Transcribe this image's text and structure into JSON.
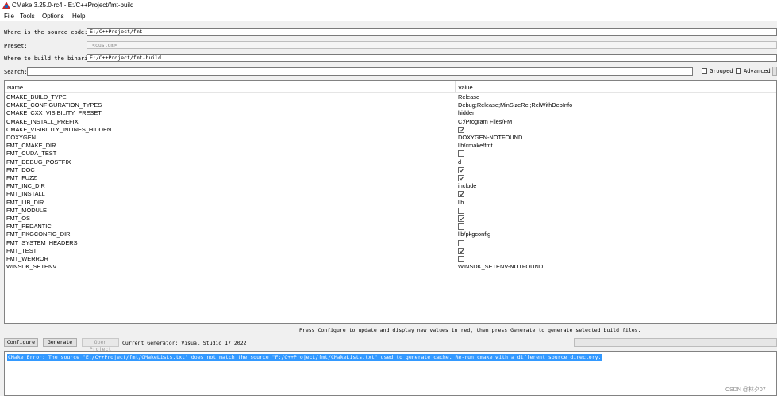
{
  "window": {
    "title": "CMake 3.25.0-rc4 - E:/C++Project/fmt-build"
  },
  "menu": [
    "File",
    "Tools",
    "Options",
    "Help"
  ],
  "paths": {
    "source_label": "Where is the source code:",
    "source_value": "E:/C++Project/fmt",
    "preset_label": "Preset:",
    "preset_value": "<custom>",
    "binaries_label": "Where to build the binaries:",
    "binaries_value": "E:/C++Project/fmt-build"
  },
  "search": {
    "label": "Search:",
    "value": ""
  },
  "options": {
    "grouped_label": "Grouped",
    "advanced_label": "Advanced"
  },
  "table": {
    "headers": {
      "name": "Name",
      "value": "Value"
    },
    "rows": [
      {
        "name": "CMAKE_BUILD_TYPE",
        "type": "text",
        "value": "Release"
      },
      {
        "name": "CMAKE_CONFIGURATION_TYPES",
        "type": "text",
        "value": "Debug;Release;MinSizeRel;RelWithDebInfo"
      },
      {
        "name": "CMAKE_CXX_VISIBILITY_PRESET",
        "type": "text",
        "value": "hidden"
      },
      {
        "name": "CMAKE_INSTALL_PREFIX",
        "type": "text",
        "value": "C:/Program Files/FMT"
      },
      {
        "name": "CMAKE_VISIBILITY_INLINES_HIDDEN",
        "type": "bool",
        "value": true
      },
      {
        "name": "DOXYGEN",
        "type": "text",
        "value": "DOXYGEN-NOTFOUND"
      },
      {
        "name": "FMT_CMAKE_DIR",
        "type": "text",
        "value": "lib/cmake/fmt"
      },
      {
        "name": "FMT_CUDA_TEST",
        "type": "bool",
        "value": false
      },
      {
        "name": "FMT_DEBUG_POSTFIX",
        "type": "text",
        "value": "d"
      },
      {
        "name": "FMT_DOC",
        "type": "bool",
        "value": true
      },
      {
        "name": "FMT_FUZZ",
        "type": "bool",
        "value": true
      },
      {
        "name": "FMT_INC_DIR",
        "type": "text",
        "value": "include"
      },
      {
        "name": "FMT_INSTALL",
        "type": "bool",
        "value": true
      },
      {
        "name": "FMT_LIB_DIR",
        "type": "text",
        "value": "lib"
      },
      {
        "name": "FMT_MODULE",
        "type": "bool",
        "value": false
      },
      {
        "name": "FMT_OS",
        "type": "bool",
        "value": true
      },
      {
        "name": "FMT_PEDANTIC",
        "type": "bool",
        "value": false
      },
      {
        "name": "FMT_PKGCONFIG_DIR",
        "type": "text",
        "value": "lib/pkgconfig"
      },
      {
        "name": "FMT_SYSTEM_HEADERS",
        "type": "bool",
        "value": false
      },
      {
        "name": "FMT_TEST",
        "type": "bool",
        "value": true
      },
      {
        "name": "FMT_WERROR",
        "type": "bool",
        "value": false
      },
      {
        "name": "WINSDK_SETENV",
        "type": "text",
        "value": "WINSDK_SETENV-NOTFOUND"
      }
    ]
  },
  "status": {
    "hint": "Press Configure to update and display new values in red, then press Generate to generate selected build files."
  },
  "buttons": {
    "configure": "Configure",
    "generate": "Generate",
    "open_project": "Open Project"
  },
  "generator": {
    "label": "Current Generator: Visual Studio 17 2022"
  },
  "output": {
    "line": "CMake Error: The source \"E:/C++Project/fmt/CMakeLists.txt\" does not match the source \"F:/C++Project/fmt/CMakeLists.txt\" used to generate cache.  Re-run cmake with a different source directory."
  },
  "watermark": "CSDN @林夕07",
  "colors": {
    "selection": "#3399ff",
    "logo_red": "#c62828",
    "logo_blue": "#1e5eb8"
  }
}
